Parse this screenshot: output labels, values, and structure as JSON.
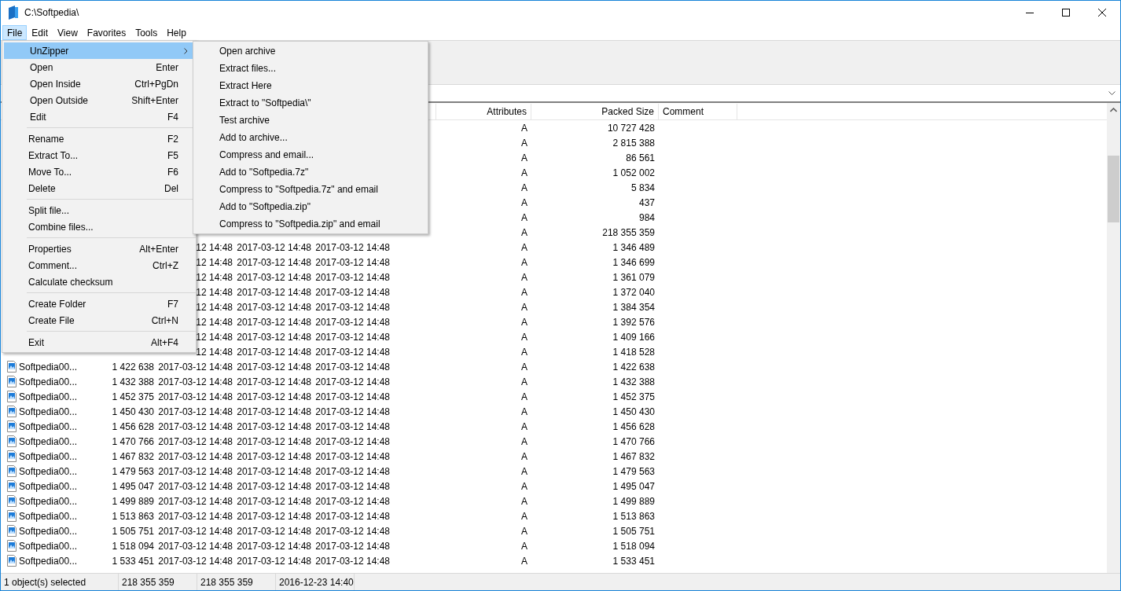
{
  "window": {
    "title": "C:\\Softpedia\\"
  },
  "menu_bar": [
    {
      "label": "File",
      "selected": true
    },
    {
      "label": "Edit",
      "selected": false
    },
    {
      "label": "View",
      "selected": false
    },
    {
      "label": "Favorites",
      "selected": false
    },
    {
      "label": "Tools",
      "selected": false
    },
    {
      "label": "Help",
      "selected": false
    }
  ],
  "file_menu": [
    [
      {
        "label": "UnZipper",
        "submenu": true,
        "selected": true
      },
      {
        "label": "Open",
        "shortcut": "Enter",
        "submenu": false,
        "selected": false
      },
      {
        "label": "Open Inside",
        "shortcut": "Ctrl+PgDn",
        "submenu": false,
        "selected": false
      },
      {
        "label": "Open Outside",
        "shortcut": "Shift+Enter",
        "submenu": false,
        "selected": false
      },
      {
        "label": "Edit",
        "shortcut": "F4",
        "submenu": false,
        "selected": false
      }
    ],
    [
      {
        "label": "Rename",
        "shortcut": "F2",
        "submenu": false,
        "selected": false
      },
      {
        "label": "Extract To...",
        "shortcut": "F5",
        "submenu": false,
        "selected": false
      },
      {
        "label": "Move To...",
        "shortcut": "F6",
        "submenu": false,
        "selected": false
      },
      {
        "label": "Delete",
        "shortcut": "Del",
        "submenu": false,
        "selected": false
      }
    ],
    [
      {
        "label": "Split file...",
        "submenu": false,
        "selected": false
      },
      {
        "label": "Combine files...",
        "submenu": false,
        "selected": false
      }
    ],
    [
      {
        "label": "Properties",
        "shortcut": "Alt+Enter",
        "submenu": false,
        "selected": false
      },
      {
        "label": "Comment...",
        "shortcut": "Ctrl+Z",
        "submenu": false,
        "selected": false
      },
      {
        "label": "Calculate checksum",
        "submenu": false,
        "selected": false
      }
    ],
    [
      {
        "label": "Create Folder",
        "shortcut": "F7",
        "submenu": false,
        "selected": false
      },
      {
        "label": "Create File",
        "shortcut": "Ctrl+N",
        "submenu": false,
        "selected": false
      }
    ],
    [
      {
        "label": "Exit",
        "shortcut": "Alt+F4",
        "submenu": false,
        "selected": false
      }
    ]
  ],
  "submenu": [
    {
      "label": "Open archive"
    },
    {
      "label": "Extract files..."
    },
    {
      "label": "Extract Here"
    },
    {
      "label": "Extract to \"Softpedia\\\""
    },
    {
      "label": "Test archive"
    },
    {
      "label": "Add to archive..."
    },
    {
      "label": "Compress and email..."
    },
    {
      "label": "Add to \"Softpedia.7z\""
    },
    {
      "label": "Compress to \"Softpedia.7z\" and email"
    },
    {
      "label": "Add to \"Softpedia.zip\""
    },
    {
      "label": "Compress to \"Softpedia.zip\" and email"
    }
  ],
  "table": {
    "columns": [
      {
        "label": "Attributes"
      },
      {
        "label": "Packed Size"
      },
      {
        "label": "Comment"
      }
    ],
    "rows": [
      {
        "attributes": "A",
        "packed": "10 727 428"
      },
      {
        "attributes": "A",
        "packed": "2 815 388"
      },
      {
        "attributes": "A",
        "packed": "86 561"
      },
      {
        "attributes": "A",
        "packed": "1 052 002"
      },
      {
        "attributes": "A",
        "packed": "5 834"
      },
      {
        "attributes": "A",
        "packed": "437"
      },
      {
        "attributes": "A",
        "packed": "984"
      },
      {
        "attributes": "A",
        "packed": "218 355 359"
      },
      {
        "modified": "12 14:48",
        "created": "2017-03-12 14:48",
        "accessed": "2017-03-12 14:48",
        "attributes": "A",
        "packed": "1 346 489"
      },
      {
        "modified": "12 14:48",
        "created": "2017-03-12 14:48",
        "accessed": "2017-03-12 14:48",
        "attributes": "A",
        "packed": "1 346 699"
      },
      {
        "modified": "12 14:48",
        "created": "2017-03-12 14:48",
        "accessed": "2017-03-12 14:48",
        "attributes": "A",
        "packed": "1 361 079"
      },
      {
        "modified": "12 14:48",
        "created": "2017-03-12 14:48",
        "accessed": "2017-03-12 14:48",
        "attributes": "A",
        "packed": "1 372 040"
      },
      {
        "modified": "12 14:48",
        "created": "2017-03-12 14:48",
        "accessed": "2017-03-12 14:48",
        "attributes": "A",
        "packed": "1 384 354"
      },
      {
        "modified": "12 14:48",
        "created": "2017-03-12 14:48",
        "accessed": "2017-03-12 14:48",
        "attributes": "A",
        "packed": "1 392 576"
      },
      {
        "modified": "12 14:48",
        "created": "2017-03-12 14:48",
        "accessed": "2017-03-12 14:48",
        "attributes": "A",
        "packed": "1 409 166"
      },
      {
        "modified": "12 14:48",
        "created": "2017-03-12 14:48",
        "accessed": "2017-03-12 14:48",
        "attributes": "A",
        "packed": "1 418 528"
      },
      {
        "name": "Softpedia00...",
        "size": "1 422 638",
        "modified": "2017-03-12 14:48",
        "created": "2017-03-12 14:48",
        "accessed": "2017-03-12 14:48",
        "attributes": "A",
        "packed": "1 422 638"
      },
      {
        "name": "Softpedia00...",
        "size": "1 432 388",
        "modified": "2017-03-12 14:48",
        "created": "2017-03-12 14:48",
        "accessed": "2017-03-12 14:48",
        "attributes": "A",
        "packed": "1 432 388"
      },
      {
        "name": "Softpedia00...",
        "size": "1 452 375",
        "modified": "2017-03-12 14:48",
        "created": "2017-03-12 14:48",
        "accessed": "2017-03-12 14:48",
        "attributes": "A",
        "packed": "1 452 375"
      },
      {
        "name": "Softpedia00...",
        "size": "1 450 430",
        "modified": "2017-03-12 14:48",
        "created": "2017-03-12 14:48",
        "accessed": "2017-03-12 14:48",
        "attributes": "A",
        "packed": "1 450 430"
      },
      {
        "name": "Softpedia00...",
        "size": "1 456 628",
        "modified": "2017-03-12 14:48",
        "created": "2017-03-12 14:48",
        "accessed": "2017-03-12 14:48",
        "attributes": "A",
        "packed": "1 456 628"
      },
      {
        "name": "Softpedia00...",
        "size": "1 470 766",
        "modified": "2017-03-12 14:48",
        "created": "2017-03-12 14:48",
        "accessed": "2017-03-12 14:48",
        "attributes": "A",
        "packed": "1 470 766"
      },
      {
        "name": "Softpedia00...",
        "size": "1 467 832",
        "modified": "2017-03-12 14:48",
        "created": "2017-03-12 14:48",
        "accessed": "2017-03-12 14:48",
        "attributes": "A",
        "packed": "1 467 832"
      },
      {
        "name": "Softpedia00...",
        "size": "1 479 563",
        "modified": "2017-03-12 14:48",
        "created": "2017-03-12 14:48",
        "accessed": "2017-03-12 14:48",
        "attributes": "A",
        "packed": "1 479 563"
      },
      {
        "name": "Softpedia00...",
        "size": "1 495 047",
        "modified": "2017-03-12 14:48",
        "created": "2017-03-12 14:48",
        "accessed": "2017-03-12 14:48",
        "attributes": "A",
        "packed": "1 495 047"
      },
      {
        "name": "Softpedia00...",
        "size": "1 499 889",
        "modified": "2017-03-12 14:48",
        "created": "2017-03-12 14:48",
        "accessed": "2017-03-12 14:48",
        "attributes": "A",
        "packed": "1 499 889"
      },
      {
        "name": "Softpedia00...",
        "size": "1 513 863",
        "modified": "2017-03-12 14:48",
        "created": "2017-03-12 14:48",
        "accessed": "2017-03-12 14:48",
        "attributes": "A",
        "packed": "1 513 863"
      },
      {
        "name": "Softpedia00...",
        "size": "1 505 751",
        "modified": "2017-03-12 14:48",
        "created": "2017-03-12 14:48",
        "accessed": "2017-03-12 14:48",
        "attributes": "A",
        "packed": "1 505 751"
      },
      {
        "name": "Softpedia00...",
        "size": "1 518 094",
        "modified": "2017-03-12 14:48",
        "created": "2017-03-12 14:48",
        "accessed": "2017-03-12 14:48",
        "attributes": "A",
        "packed": "1 518 094"
      },
      {
        "name": "Softpedia00...",
        "size": "1 533 451",
        "modified": "2017-03-12 14:48",
        "created": "2017-03-12 14:48",
        "accessed": "2017-03-12 14:48",
        "attributes": "A",
        "packed": "1 533 451"
      }
    ]
  },
  "status_bar": [
    "1 object(s) selected",
    "218 355 359",
    "218 355 359",
    "2016-12-23 14:40"
  ]
}
